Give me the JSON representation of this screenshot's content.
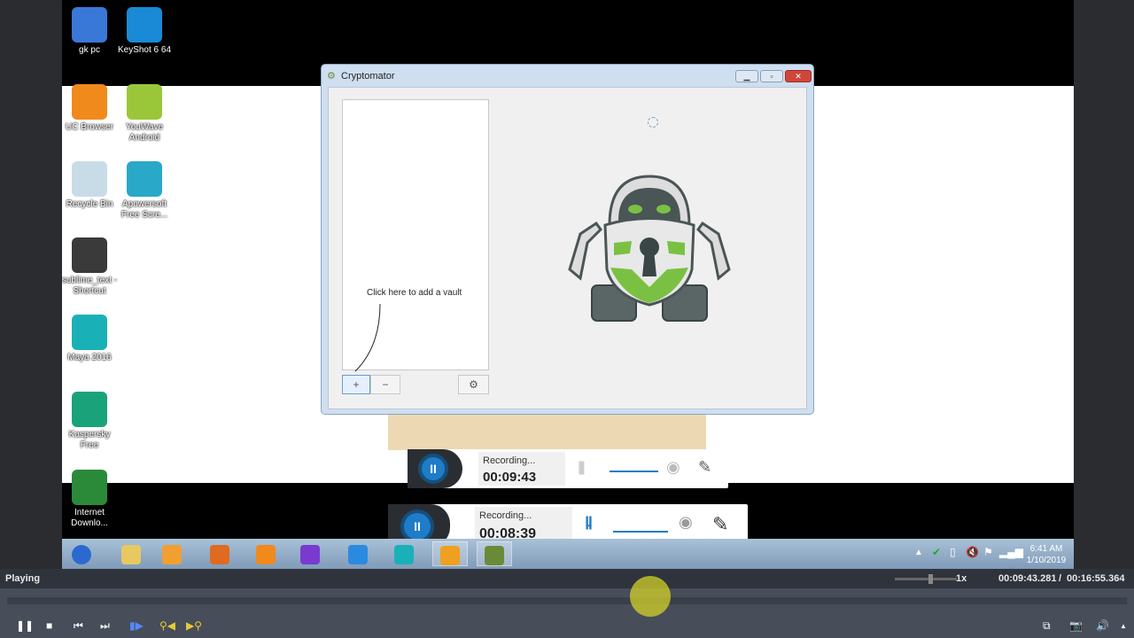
{
  "desktop": {
    "icons": [
      {
        "label": "gk pc",
        "icon": "computer-icon",
        "color": "#3a78d8"
      },
      {
        "label": "KeyShot 6 64",
        "icon": "keyshot-icon",
        "color": "#1a8ad6"
      },
      {
        "label": "UC Browser",
        "icon": "uc-browser-icon",
        "color": "#f08a1c"
      },
      {
        "label": "YouWave Android",
        "icon": "android-icon",
        "color": "#9ac73a"
      },
      {
        "label": "Recycle Bin",
        "icon": "recycle-bin-icon",
        "color": "#c8dce8"
      },
      {
        "label": "Apowersoft Free Scre...",
        "icon": "apowersoft-icon",
        "color": "#2aa8c8"
      },
      {
        "label": "sublime_text - Shortcut",
        "icon": "sublime-icon",
        "color": "#3a3a3a"
      },
      {
        "label": "Maya 2016",
        "icon": "maya-icon",
        "color": "#1ab0b8"
      },
      {
        "label": "Kaspersky Free",
        "icon": "kaspersky-icon",
        "color": "#1aa37a"
      },
      {
        "label": "Internet Downlo...",
        "icon": "idm-icon",
        "color": "#2a8a3a"
      }
    ]
  },
  "window": {
    "title": "Cryptomator",
    "hint": "Click here to add a vault",
    "add_label": "+",
    "remove_label": "−",
    "settings_icon": "gear-icon",
    "accent": "#7ac143"
  },
  "recorders": [
    {
      "status": "Recording...",
      "time": "00:09:43"
    },
    {
      "status": "Recording...",
      "time": "00:08:39"
    }
  ],
  "taskbar": {
    "items": [
      "windows-start-icon",
      "file-explorer-icon",
      "media-player-icon",
      "firefox-icon",
      "uc-browser-icon",
      "visual-studio-icon",
      "internet-explorer-icon",
      "maya-icon",
      "sublime-icon",
      "cryptomator-icon"
    ],
    "time": "6:41 AM",
    "date": "1/10/2019"
  },
  "player": {
    "status": "Playing",
    "speed": "1x",
    "position": "00:09:43.281",
    "duration": "00:16:55.364",
    "progress": 0.574
  }
}
